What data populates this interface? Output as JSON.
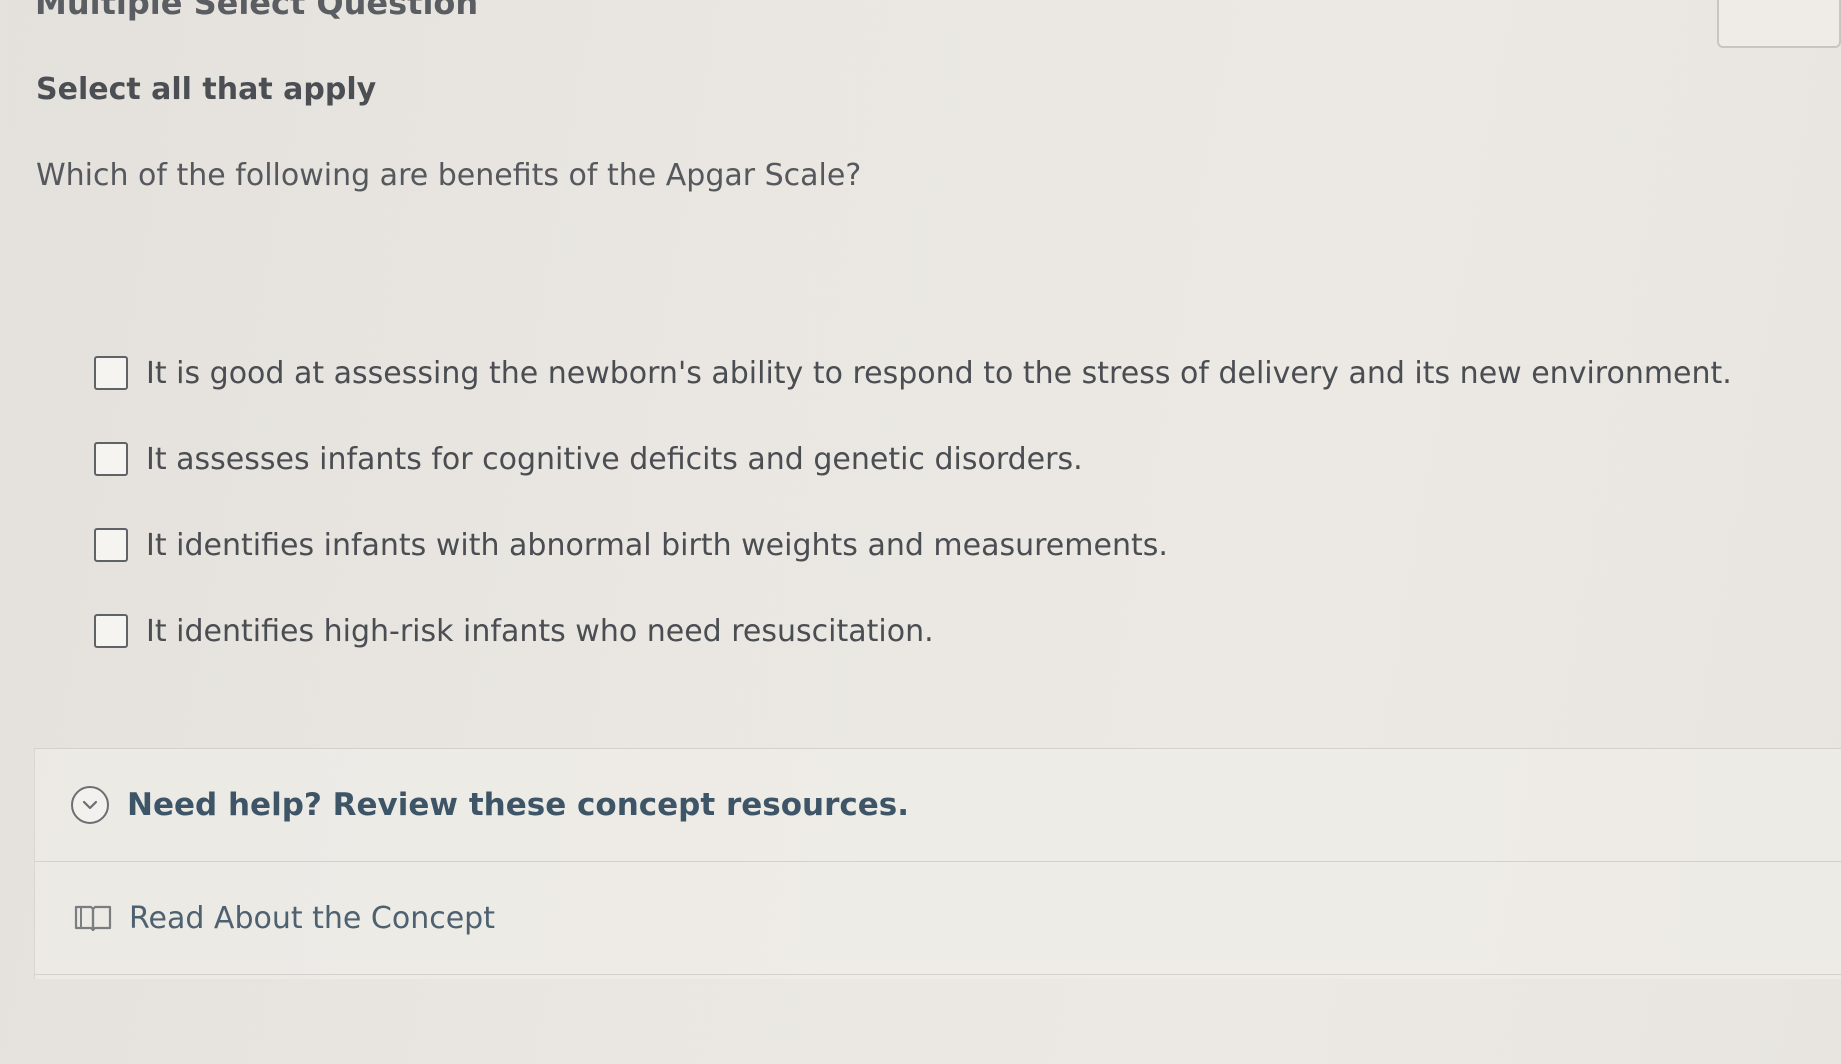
{
  "header": {
    "title": "Multiple Select Question"
  },
  "question": {
    "instruction": "Select all that apply",
    "prompt": "Which of the following are benefits of the Apgar Scale?",
    "options": [
      {
        "label": "It is good at assessing the newborn's ability to respond to the stress of delivery and its new environment.",
        "checked": false
      },
      {
        "label": "It assesses infants for cognitive deficits and genetic disorders.",
        "checked": false
      },
      {
        "label": "It identifies infants with abnormal birth weights and measurements.",
        "checked": false
      },
      {
        "label": "It identifies high-risk infants who need resuscitation.",
        "checked": false
      }
    ]
  },
  "help": {
    "title": "Need help? Review these concept resources.",
    "icon": "chevron-down-icon",
    "resources": [
      {
        "label": "Read About the Concept",
        "icon": "book-icon"
      }
    ]
  }
}
